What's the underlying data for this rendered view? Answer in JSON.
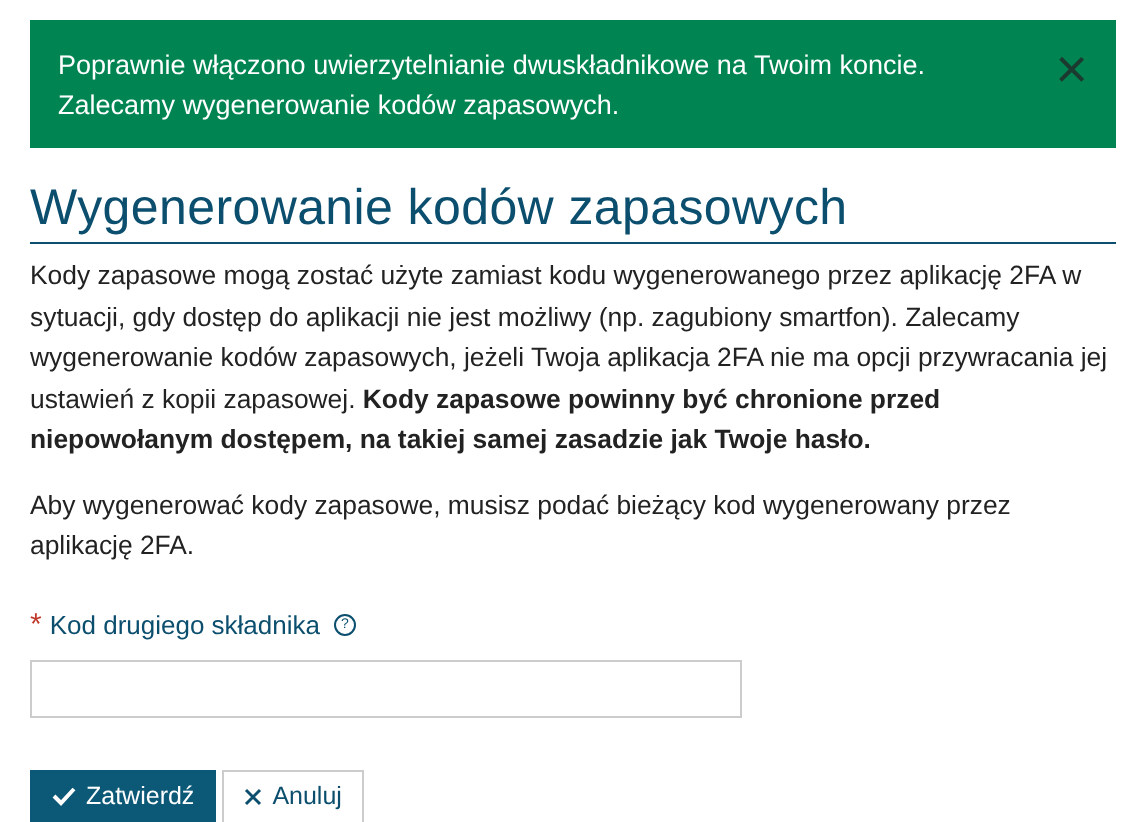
{
  "alert": {
    "message": "Poprawnie włączono uwierzytelnianie dwuskładnikowe na Twoim koncie. Zalecamy wygenerowanie kodów zapasowych.",
    "close": "×"
  },
  "heading": "Wygenerowanie kodów zapasowych",
  "paragraphs": [
    "Kody zapasowe mogą zostać użyte zamiast kodu wygenerowanego przez aplikację 2FA w sytuacji, gdy dostęp do aplikacji nie jest możliwy (np. zagubiony smartfon). Zalecamy wygenerowanie kodów zapasowych, jeżeli Twoja aplikacja 2FA nie ma opcji przywracania jej ustawień z kopii zapasowej. **Kody zapasowe powinny być chronione przed niepowołanym dostępem, na takiej samej zasadzie jak Twoje hasło.**",
    "Aby wygenerować kody zapasowe, musisz podać bieżący kod wygenerowany przez aplikację 2FA."
  ],
  "field": {
    "required_mark": "*",
    "label": "Kod drugiego składnika",
    "help": "?"
  },
  "buttons": [
    {
      "kind": "primary",
      "label": "Zatwierdź"
    },
    {
      "kind": "secondary",
      "label": "Anuluj"
    }
  ]
}
